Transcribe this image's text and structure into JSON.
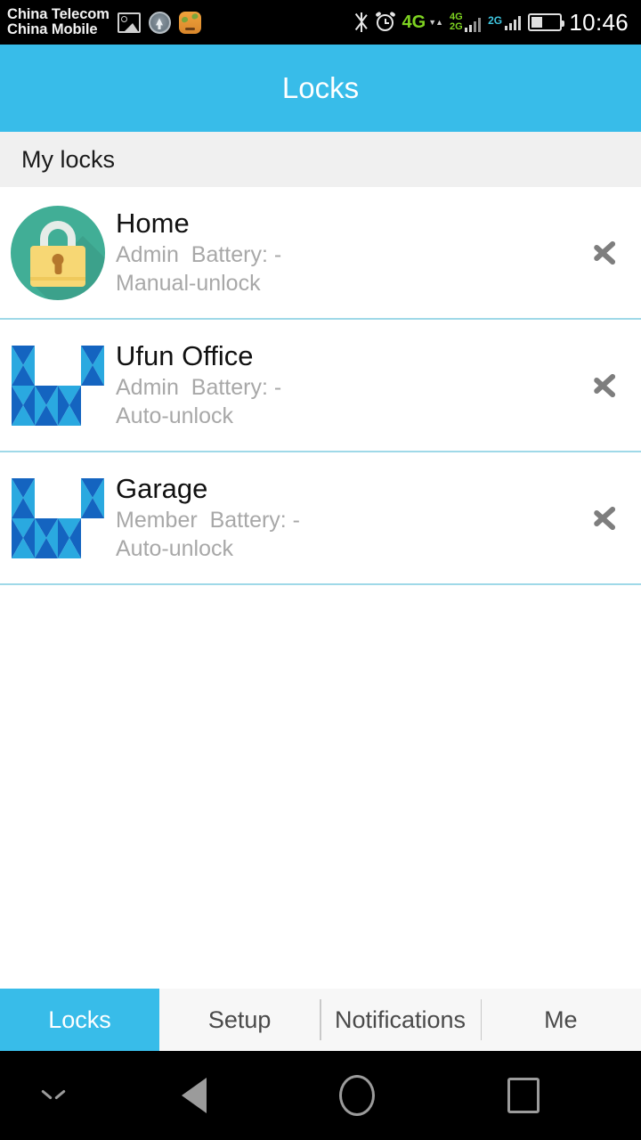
{
  "status_bar": {
    "carrier_line1": "China Telecom",
    "carrier_line2": "China Mobile",
    "icons": [
      "photo-icon",
      "system-update-icon",
      "alien-app-icon",
      "bluetooth-icon",
      "alarm-icon"
    ],
    "sim1_network": "4G",
    "sim2_network_top": "4G",
    "sim2_network_bottom": "2G",
    "sim3_network": "2G",
    "battery_level": "40%",
    "time": "10:46"
  },
  "app_bar": {
    "title": "Locks"
  },
  "section": {
    "header": "My locks"
  },
  "locks": [
    {
      "name": "Home",
      "role": "Admin",
      "battery": "Battery: -",
      "unlock_mode": "Manual-unlock",
      "icon": "padlock-avatar-icon"
    },
    {
      "name": "Ufun Office",
      "role": "Admin",
      "battery": "Battery: -",
      "unlock_mode": "Auto-unlock",
      "icon": "ufun-u-logo-icon"
    },
    {
      "name": "Garage",
      "role": "Member",
      "battery": "Battery: -",
      "unlock_mode": "Auto-unlock",
      "icon": "ufun-u-logo-icon"
    }
  ],
  "tabs": [
    {
      "label": "Locks",
      "active": true
    },
    {
      "label": "Setup",
      "active": false
    },
    {
      "label": "Notifications",
      "active": false
    },
    {
      "label": "Me",
      "active": false
    }
  ],
  "nav_bar": {
    "hide": "chevron-down-icon",
    "back": "back-triangle-icon",
    "home": "home-circle-icon",
    "recents": "recents-square-icon"
  },
  "colors": {
    "accent": "#38bce9",
    "divider": "#9fd9e8",
    "section_bg": "#f0f0f0",
    "meta_text": "#a8a8a8",
    "lock_avatar": "#41ae96",
    "lock_body": "#f7d774",
    "logo_blue_light": "#2aa9e0",
    "logo_blue_dark": "#1464c0"
  }
}
